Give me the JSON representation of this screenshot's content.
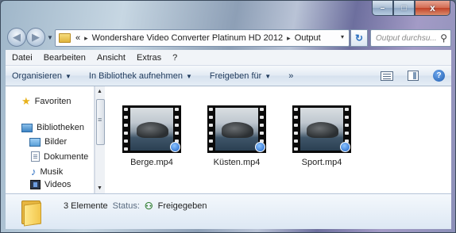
{
  "window": {
    "controls": {
      "minimize": "–",
      "maximize": "□",
      "close": "x"
    }
  },
  "address": {
    "overflow": "«",
    "crumbs": [
      "Wondershare Video Converter Platinum HD 2012",
      "Output"
    ],
    "separator": "▸",
    "dropdown": "▾",
    "refresh": "↻"
  },
  "search": {
    "placeholder": "Output durchsu..."
  },
  "menu": [
    "Datei",
    "Bearbeiten",
    "Ansicht",
    "Extras",
    "?"
  ],
  "commands": {
    "organize": "Organisieren",
    "library": "In Bibliothek aufnehmen",
    "share": "Freigeben für",
    "more": "»"
  },
  "navpane": {
    "favorites": "Favoriten",
    "libraries": "Bibliotheken",
    "items": [
      "Bilder",
      "Dokumente",
      "Musik",
      "Videos"
    ]
  },
  "files": [
    {
      "name": "Berge.mp4"
    },
    {
      "name": "Küsten.mp4"
    },
    {
      "name": "Sport.mp4"
    }
  ],
  "details": {
    "count": "3 Elemente",
    "status_label": "Status:",
    "status_value": "Freigegeben"
  },
  "icons": {
    "favorites": "star-icon",
    "libraries": "library-icon",
    "pictures": "pictures-icon",
    "documents": "document-icon",
    "music": "music-icon",
    "videos": "videos-icon",
    "folder": "folder-icon",
    "shared": "shared-users-icon",
    "help": "help-icon"
  },
  "colors": {
    "accent": "#1e395b",
    "window_frame": "#8d9fb6"
  }
}
